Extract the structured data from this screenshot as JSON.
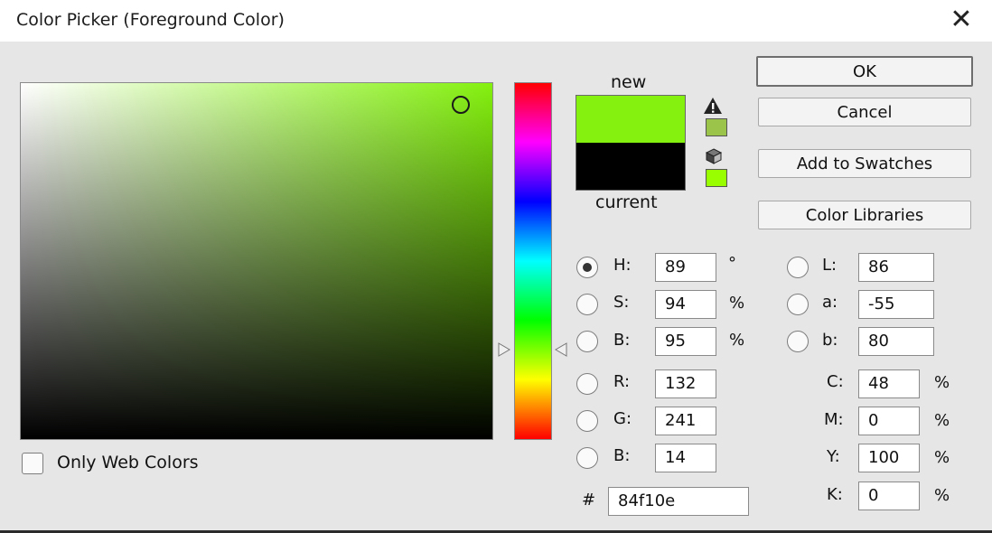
{
  "window": {
    "title": "Color Picker (Foreground Color)",
    "close_glyph": "✕"
  },
  "color": {
    "new_hex": "#84f10e",
    "current_hex": "#000000",
    "gamut_hex": "#9bc44b",
    "web_safe_hex": "#99ff00"
  },
  "labels": {
    "new": "new",
    "current": "current",
    "only_web_colors": "Only Web Colors",
    "hash": "#"
  },
  "buttons": {
    "ok": "OK",
    "cancel": "Cancel",
    "add_to_swatches": "Add to Swatches",
    "color_libraries": "Color Libraries"
  },
  "icons": {
    "gamut_warning": "warning-icon",
    "web_safe": "cube-icon"
  },
  "hsb": {
    "h": {
      "label": "H:",
      "value": "89",
      "unit": "°",
      "checked": true
    },
    "s": {
      "label": "S:",
      "value": "94",
      "unit": "%"
    },
    "b": {
      "label": "B:",
      "value": "95",
      "unit": "%"
    }
  },
  "rgb": {
    "r": {
      "label": "R:",
      "value": "132"
    },
    "g": {
      "label": "G:",
      "value": "241"
    },
    "b": {
      "label": "B:",
      "value": "14"
    }
  },
  "lab": {
    "l": {
      "label": "L:",
      "value": "86"
    },
    "a": {
      "label": "a:",
      "value": "-55"
    },
    "b": {
      "label": "b:",
      "value": "80"
    }
  },
  "cmyk": {
    "c": {
      "label": "C:",
      "value": "48",
      "unit": "%"
    },
    "m": {
      "label": "M:",
      "value": "0",
      "unit": "%"
    },
    "y": {
      "label": "Y:",
      "value": "100",
      "unit": "%"
    },
    "k": {
      "label": "K:",
      "value": "0",
      "unit": "%"
    }
  },
  "hex": {
    "value": "84f10e"
  }
}
